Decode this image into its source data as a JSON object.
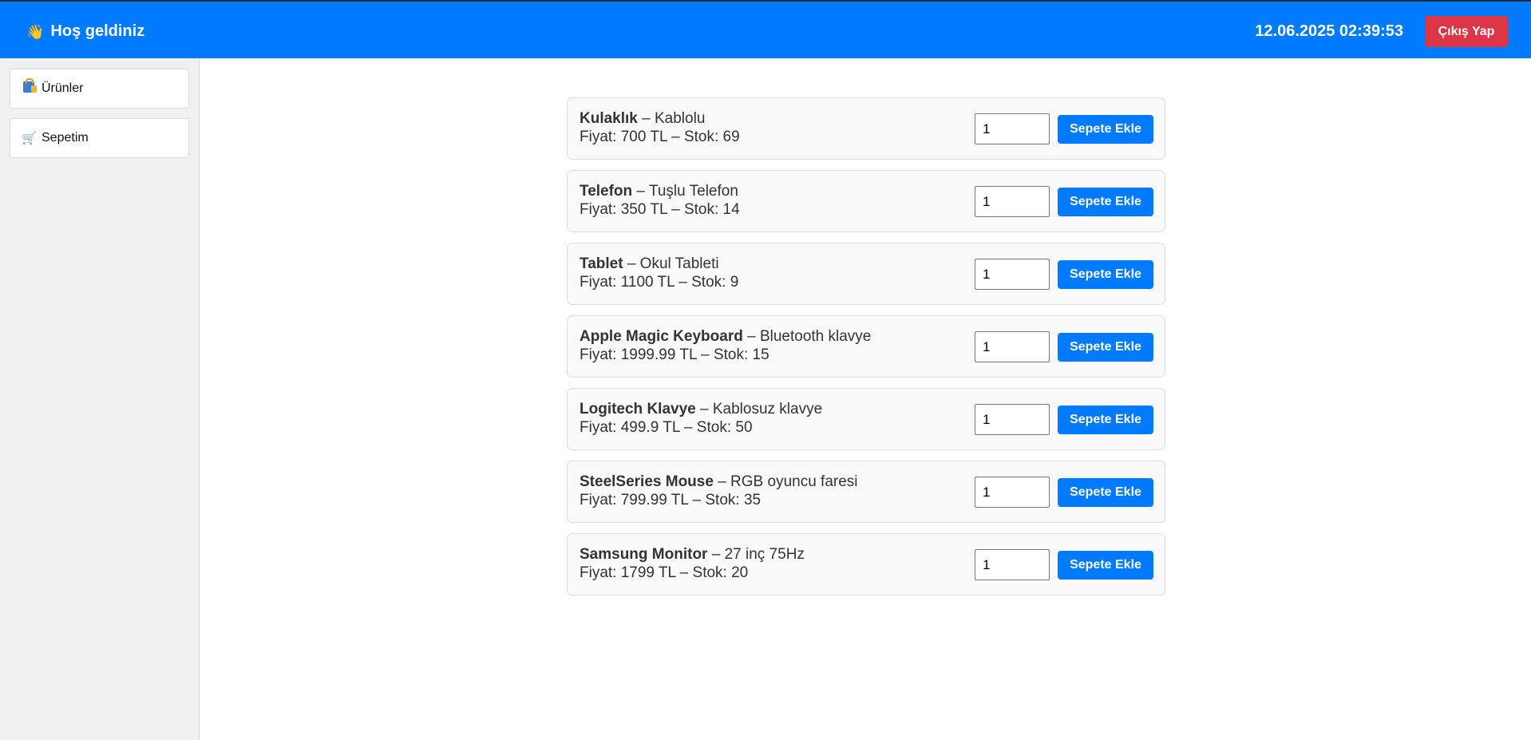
{
  "header": {
    "wave_icon": "👋",
    "welcome": "Hoş geldiniz",
    "datetime": "12.06.2025 02:39:53",
    "logout_label": "Çıkış Yap"
  },
  "sidebar": {
    "items": [
      {
        "icon": "shopping-bags-icon",
        "label": "Ürünler"
      },
      {
        "icon": "🛒",
        "label": "Sepetim"
      }
    ]
  },
  "products": [
    {
      "name": "Kulaklık",
      "sep": " – ",
      "desc": "Kablolu",
      "line2": "Fiyat: 700 TL – Stok: 69",
      "qty": "1",
      "button": "Sepete Ekle"
    },
    {
      "name": "Telefon",
      "sep": " – ",
      "desc": "Tuşlu Telefon",
      "line2": "Fiyat: 350 TL – Stok: 14",
      "qty": "1",
      "button": "Sepete Ekle"
    },
    {
      "name": "Tablet",
      "sep": " – ",
      "desc": "Okul Tableti",
      "line2": "Fiyat: 1100 TL – Stok: 9",
      "qty": "1",
      "button": "Sepete Ekle"
    },
    {
      "name": "Apple Magic Keyboard",
      "sep": " – ",
      "desc": "Bluetooth klavye",
      "line2": "Fiyat: 1999.99 TL – Stok: 15",
      "qty": "1",
      "button": "Sepete Ekle"
    },
    {
      "name": "Logitech Klavye",
      "sep": " – ",
      "desc": "Kablosuz klavye",
      "line2": "Fiyat: 499.9 TL – Stok: 50",
      "qty": "1",
      "button": "Sepete Ekle"
    },
    {
      "name": "SteelSeries Mouse",
      "sep": " – ",
      "desc": "RGB oyuncu faresi",
      "line2": "Fiyat: 799.99 TL – Stok: 35",
      "qty": "1",
      "button": "Sepete Ekle"
    },
    {
      "name": "Samsung Monitor",
      "sep": " – ",
      "desc": "27 inç 75Hz",
      "line2": "Fiyat: 1799 TL – Stok: 20",
      "qty": "1",
      "button": "Sepete Ekle"
    }
  ],
  "colors": {
    "primary": "#007bff",
    "danger": "#dc3545",
    "sidebar_bg": "#f0f0f0",
    "card_bg": "#f9f9f9"
  }
}
